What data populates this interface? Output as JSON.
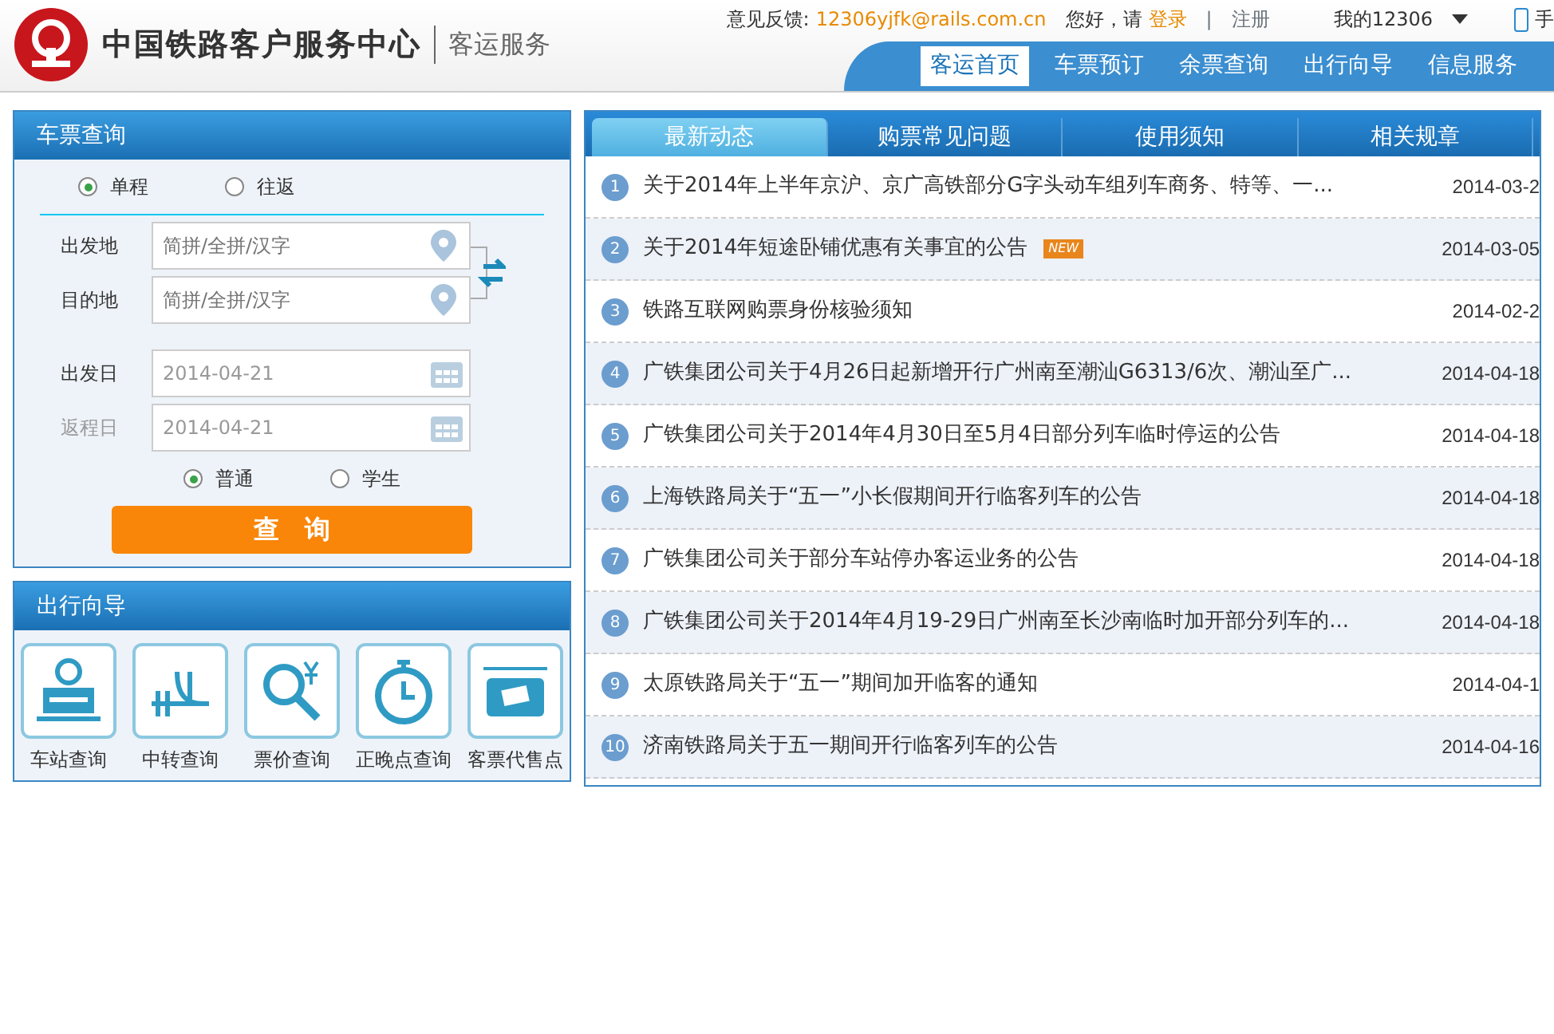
{
  "header": {
    "title": "中国铁路客户服务中心",
    "subtitle": "客运服务",
    "feedback_label": "意见反馈:",
    "feedback_email": "12306yjfk@rails.com.cn",
    "greeting": "您好，请",
    "login": "登录",
    "separator": "|",
    "register": "注册",
    "my_account": "我的12306",
    "mobile": "手"
  },
  "nav": [
    {
      "label": "客运首页",
      "selected": true
    },
    {
      "label": "车票预订",
      "selected": false
    },
    {
      "label": "余票查询",
      "selected": false
    },
    {
      "label": "出行向导",
      "selected": false
    },
    {
      "label": "信息服务",
      "selected": false
    }
  ],
  "ticket_query": {
    "title": "车票查询",
    "trip_types": [
      {
        "label": "单程",
        "selected": true
      },
      {
        "label": "往返",
        "selected": false
      }
    ],
    "from": {
      "label": "出发地",
      "placeholder": "简拼/全拼/汉字"
    },
    "to": {
      "label": "目的地",
      "placeholder": "简拼/全拼/汉字"
    },
    "depart_date": {
      "label": "出发日",
      "value": "2014-04-21"
    },
    "return_date": {
      "label": "返程日",
      "value": "2014-04-21",
      "disabled": true
    },
    "passenger_types": [
      {
        "label": "普通",
        "selected": true
      },
      {
        "label": "学生",
        "selected": false
      }
    ],
    "search_button": "查　询"
  },
  "guide": {
    "title": "出行向导",
    "items": [
      {
        "label": "车站查询",
        "kind": "station"
      },
      {
        "label": "中转查询",
        "kind": "transfer"
      },
      {
        "label": "票价查询",
        "kind": "price"
      },
      {
        "label": "正晚点查询",
        "kind": "clock"
      },
      {
        "label": "客票代售点",
        "kind": "agent"
      }
    ]
  },
  "news": {
    "tabs": [
      {
        "label": "最新动态",
        "selected": true
      },
      {
        "label": "购票常见问题",
        "selected": false
      },
      {
        "label": "使用须知",
        "selected": false
      },
      {
        "label": "相关规章",
        "selected": false
      }
    ],
    "items": [
      {
        "number": "1",
        "title": "关于2014年上半年京沪、京广高铁部分G字头动车组列车商务、特等、一...",
        "date": "2014-03-2",
        "is_new": false
      },
      {
        "number": "2",
        "title": "关于2014年短途卧铺优惠有关事宜的公告",
        "date": "2014-03-05",
        "is_new": true,
        "new_label": "NEW"
      },
      {
        "number": "3",
        "title": "铁路互联网购票身份核验须知",
        "date": "2014-02-2",
        "is_new": false
      },
      {
        "number": "4",
        "title": "广铁集团公司关于4月26日起新增开行广州南至潮汕G6313/6次、潮汕至广...",
        "date": "2014-04-18",
        "is_new": false
      },
      {
        "number": "5",
        "title": "广铁集团公司关于2014年4月30日至5月4日部分列车临时停运的公告",
        "date": "2014-04-18",
        "is_new": false
      },
      {
        "number": "6",
        "title": "上海铁路局关于“五一”小长假期间开行临客列车的公告",
        "date": "2014-04-18",
        "is_new": false
      },
      {
        "number": "7",
        "title": "广铁集团公司关于部分车站停办客运业务的公告",
        "date": "2014-04-18",
        "is_new": false
      },
      {
        "number": "8",
        "title": "广铁集团公司关于2014年4月19-29日广州南至长沙南临时加开部分列车的...",
        "date": "2014-04-18",
        "is_new": false
      },
      {
        "number": "9",
        "title": "太原铁路局关于“五一”期间加开临客的通知",
        "date": "2014-04-1",
        "is_new": false
      },
      {
        "number": "10",
        "title": "济南铁路局关于五一期间开行临客列车的公告",
        "date": "2014-04-16",
        "is_new": false
      }
    ]
  }
}
